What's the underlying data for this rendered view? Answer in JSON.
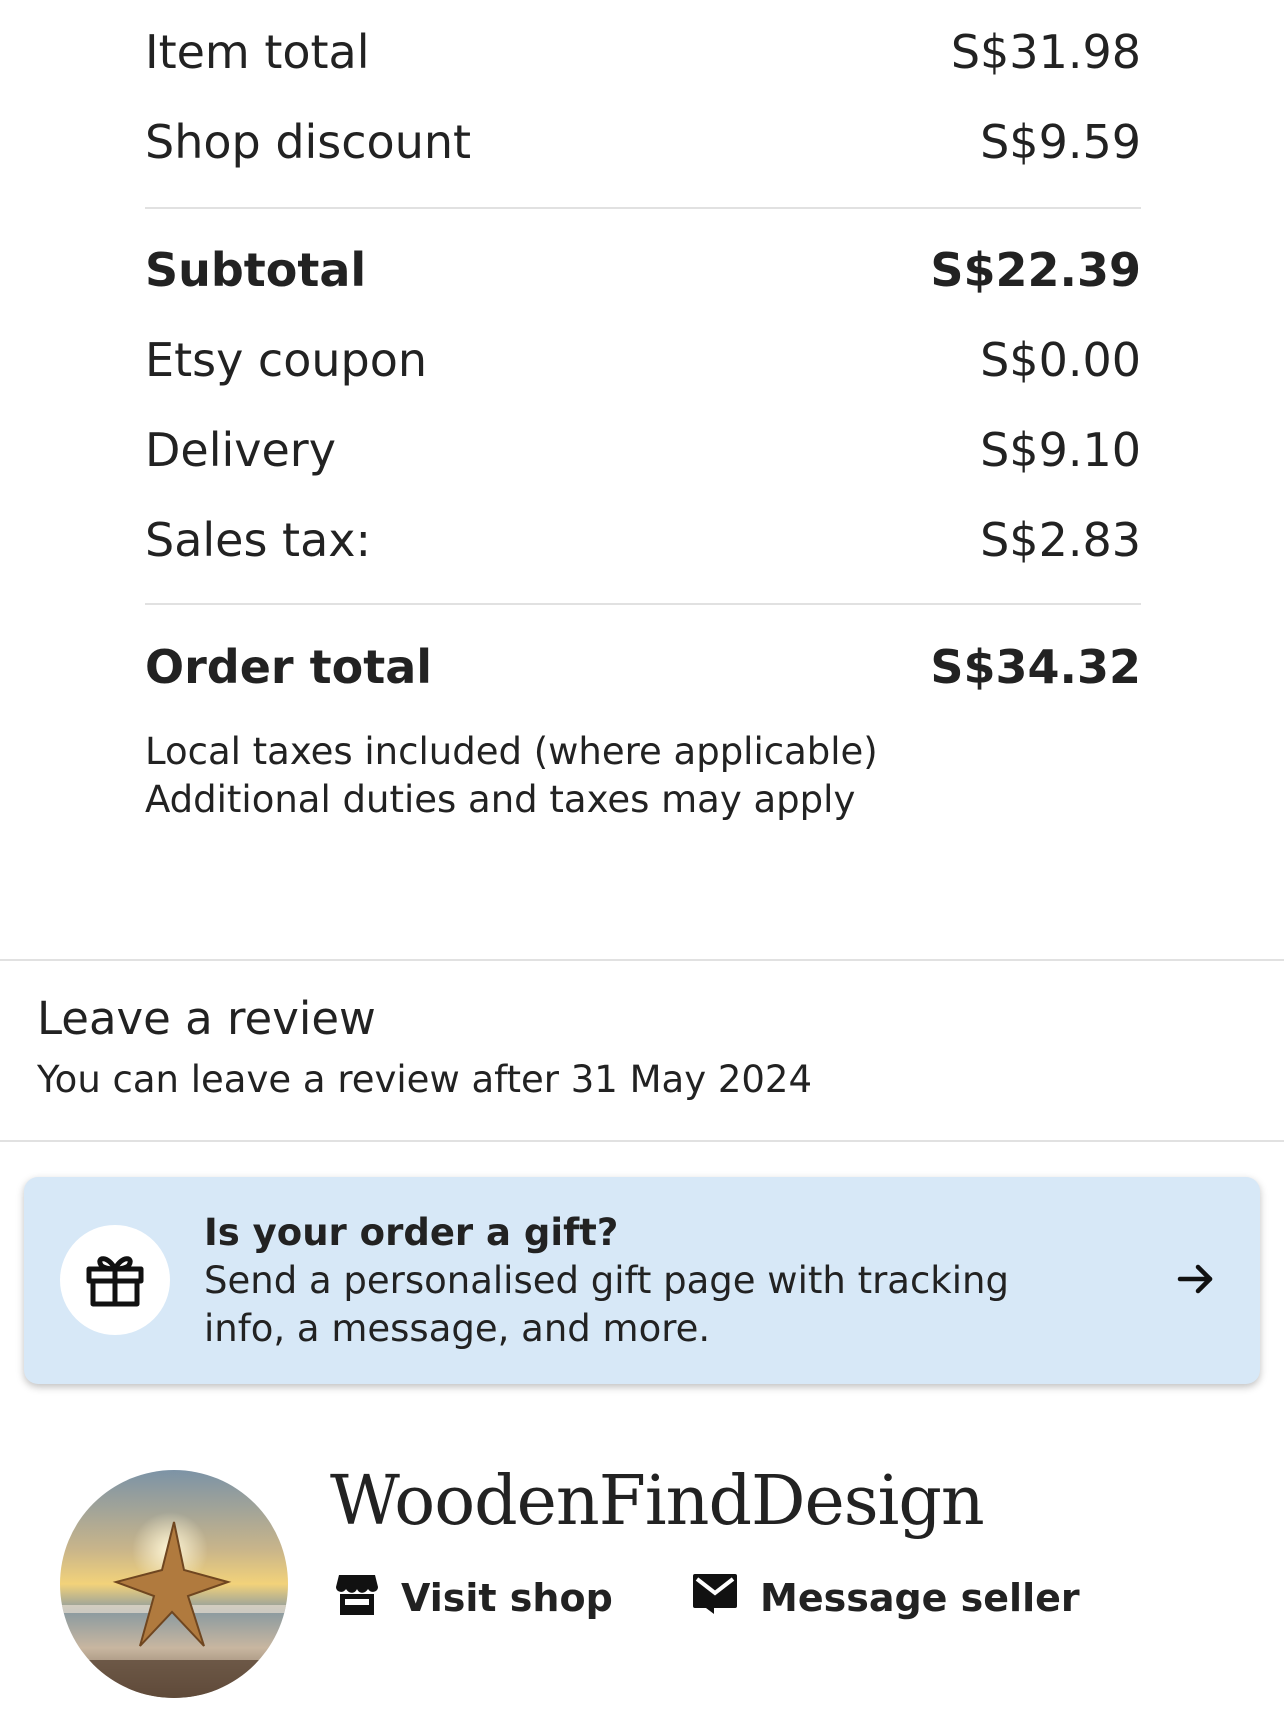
{
  "summary": {
    "item_total": {
      "label": "Item total",
      "value": "S$31.98"
    },
    "shop_discount": {
      "label": "Shop discount",
      "value": "S$9.59"
    },
    "subtotal": {
      "label": "Subtotal",
      "value": "S$22.39"
    },
    "etsy_coupon": {
      "label": "Etsy coupon",
      "value": "S$0.00"
    },
    "delivery": {
      "label": "Delivery",
      "value": "S$9.10"
    },
    "sales_tax": {
      "label": "Sales tax:",
      "value": "S$2.83"
    },
    "order_total": {
      "label": "Order total",
      "value": "S$34.32"
    },
    "tax_note_1": "Local taxes included (where applicable)",
    "tax_note_2": "Additional duties and taxes may apply"
  },
  "review": {
    "title": "Leave a review",
    "subtitle": "You can leave a review after 31 May 2024"
  },
  "gift": {
    "title": "Is your order a gift?",
    "body": "Send a personalised gift page with tracking info, a message, and more.",
    "icon": "gift-icon",
    "arrow_icon": "arrow-right-icon",
    "background": "#d7e8f7"
  },
  "shop": {
    "name": "WoodenFindDesign",
    "visit_label": "Visit shop",
    "message_label": "Message seller",
    "visit_icon": "storefront-icon",
    "message_icon": "envelope-icon"
  }
}
